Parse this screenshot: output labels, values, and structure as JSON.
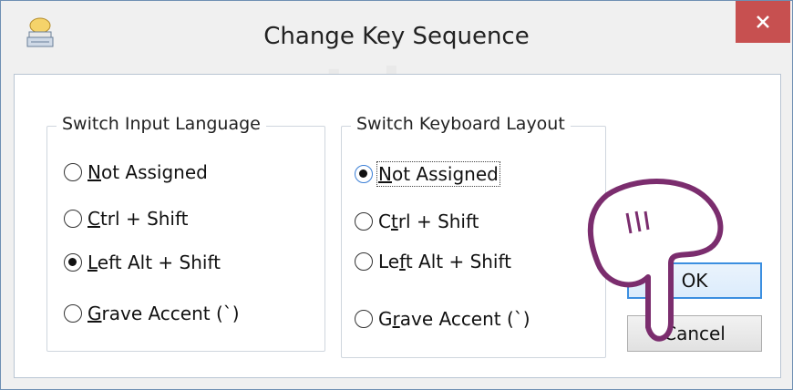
{
  "window": {
    "title": "Change Key Sequence",
    "close_label": "✕"
  },
  "watermark": "uantrimang",
  "groups": {
    "input_language": {
      "legend": "Switch Input Language",
      "options": [
        {
          "prefix": "",
          "mnemonic": "N",
          "suffix": "ot Assigned",
          "checked": false
        },
        {
          "prefix": "",
          "mnemonic": "C",
          "suffix": "trl + Shift",
          "checked": false
        },
        {
          "prefix": "",
          "mnemonic": "L",
          "suffix": "eft Alt + Shift",
          "checked": true
        },
        {
          "prefix": "",
          "mnemonic": "G",
          "suffix": "rave Accent (`)",
          "checked": false
        }
      ]
    },
    "keyboard_layout": {
      "legend": "Switch Keyboard Layout",
      "options": [
        {
          "prefix": "",
          "mnemonic": "N",
          "suffix": "ot Assigned",
          "checked": true
        },
        {
          "prefix": "C",
          "mnemonic": "t",
          "suffix": "rl + Shift",
          "checked": false
        },
        {
          "prefix": "Le",
          "mnemonic": "f",
          "suffix": "t Alt + Shift",
          "checked": false
        },
        {
          "prefix": "G",
          "mnemonic": "r",
          "suffix": "ave Accent (`)",
          "checked": false
        }
      ]
    }
  },
  "buttons": {
    "ok": "OK",
    "cancel": "Cancel"
  },
  "colors": {
    "close_bg": "#c75050",
    "default_button_border": "#3c8fe0",
    "hand_outline": "#7b2d6e"
  }
}
